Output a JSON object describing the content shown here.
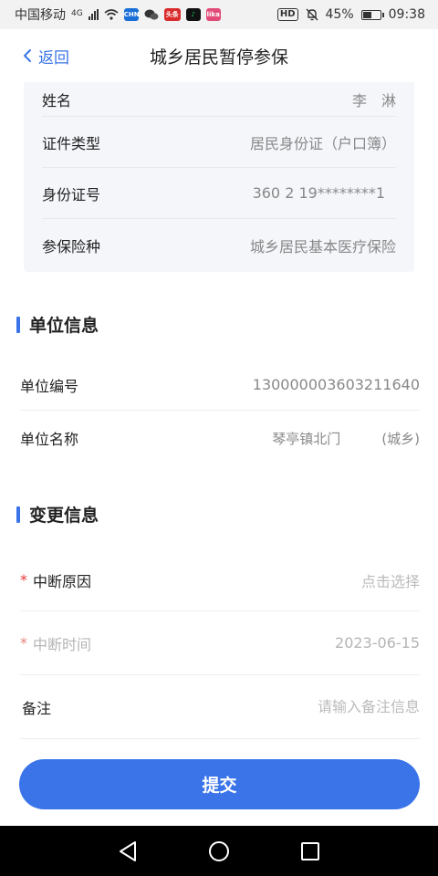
{
  "status_bar": {
    "carrier": "中国移动",
    "network": "4G",
    "hd": "HD",
    "battery": "45%",
    "time": "09:38",
    "app_badges": [
      {
        "name": "app-badge-1",
        "color": "#1a6fd6",
        "text": "CHN"
      },
      {
        "name": "app-badge-2",
        "color": "#d92b2b",
        "text": "头条"
      },
      {
        "name": "app-badge-3",
        "color": "#14b05b",
        "text": "♪"
      },
      {
        "name": "app-badge-4",
        "color": "#e24b78",
        "text": "lika"
      }
    ]
  },
  "nav": {
    "back_label": "返回",
    "title": "城乡居民暂停参保"
  },
  "personal": {
    "rows": [
      {
        "label": "姓名",
        "value": "李　淋"
      },
      {
        "label": "证件类型",
        "value": "居民身份证（户口簿）"
      },
      {
        "label": "身份证号",
        "value": "360  2  19********1"
      },
      {
        "label": "参保险种",
        "value": "城乡居民基本医疗保险"
      }
    ]
  },
  "unit_section": {
    "title": "单位信息",
    "rows": [
      {
        "label": "单位编号",
        "value": "130000003603211640"
      },
      {
        "label": "单位名称",
        "value": "琴亭镇北门　　　(城乡)"
      }
    ]
  },
  "change_section": {
    "title": "变更信息",
    "reason": {
      "required": "*",
      "label": "中断原因",
      "placeholder": "点击选择"
    },
    "time": {
      "required": "*",
      "label": "中断时间",
      "value": "2023-06-15"
    },
    "remark": {
      "label": "备注",
      "placeholder": "请输入备注信息"
    }
  },
  "submit_label": "提交",
  "colors": {
    "accent": "#3a74e8",
    "required": "#e53935",
    "card_bg": "#f4f6fa"
  }
}
